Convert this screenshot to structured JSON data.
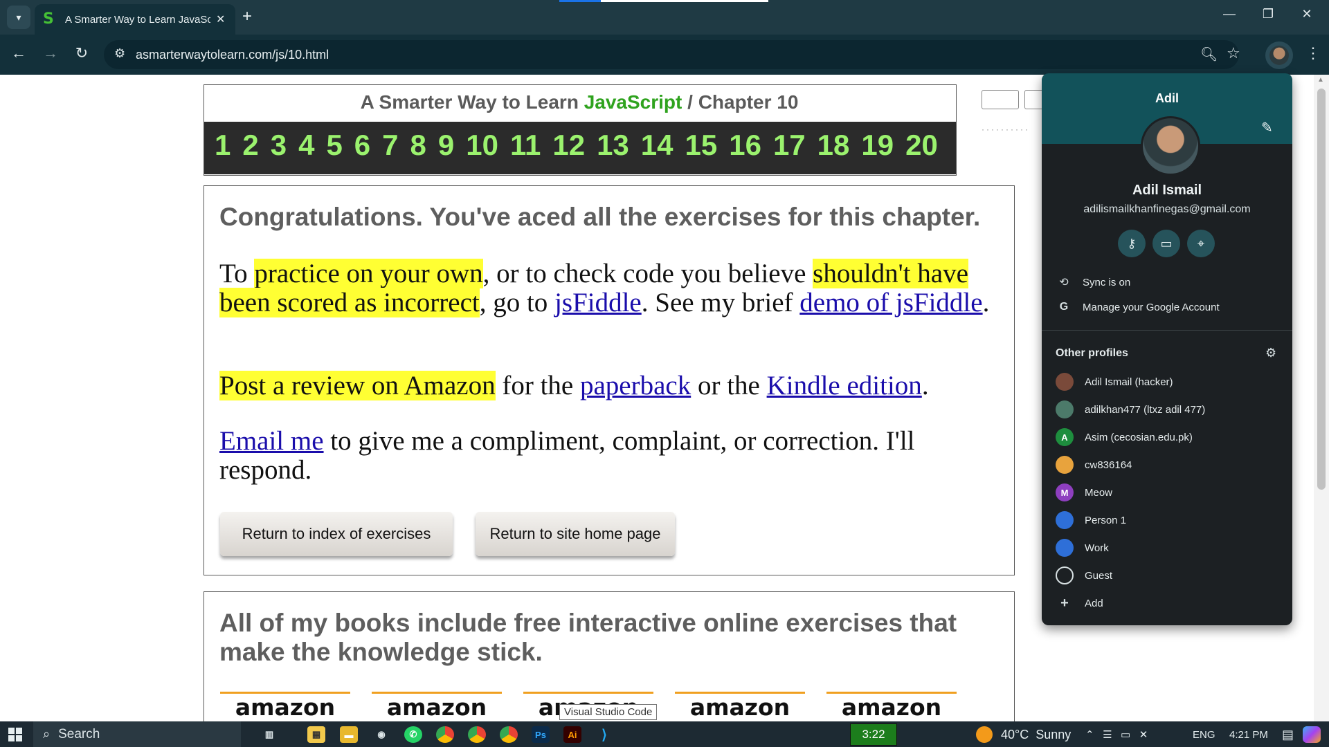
{
  "browser": {
    "tab_title": "A Smarter Way to Learn JavaScr",
    "tab_favicon": "S",
    "url": "asmarterwaytolearn.com/js/10.html",
    "icons": {
      "back": "arrow-left-icon",
      "forward": "arrow-right-icon",
      "reload": "reload-icon",
      "site_info": "tune-icon",
      "zoom": "zoom-icon",
      "bookmark": "star-icon",
      "menu": "kebab-icon"
    }
  },
  "page": {
    "header": {
      "prefix": "A Smarter Way to Learn ",
      "js": "JavaScript",
      "sep": " / ",
      "chapter": "Chapter 10"
    },
    "chapters": [
      "1",
      "2",
      "3",
      "4",
      "5",
      "6",
      "7",
      "8",
      "9",
      "10",
      "11",
      "12",
      "13",
      "14",
      "15",
      "16",
      "17",
      "18",
      "19",
      "20"
    ],
    "congrats": "Congratulations. You've aced all the exercises for this chapter.",
    "p1": {
      "t1": "To ",
      "hl1": "practice on your own",
      "t2": ", or to check code you believe ",
      "hl2": "shouldn't have been scored as incorrect",
      "t3": ", go to ",
      "link1": "jsFiddle",
      "t4": ". See my brief ",
      "link2": "demo of jsFiddle",
      "t5": "."
    },
    "p2": {
      "hl": "Post a review on Amazon",
      "t1": " for the ",
      "link1": "paperback",
      "t2": " or the ",
      "link2": "Kindle edition",
      "t3": "."
    },
    "p3": {
      "link": "Email me",
      "t1": " to give me a compliment, complaint, or correction. I'll respond."
    },
    "buttons": {
      "index": "Return to index of exercises",
      "home": "Return to site home page"
    },
    "books_text": "All of my books include free interactive online exercises that make the knowledge stick.",
    "amazon_label": "amazon",
    "tooltip": "Visual Studio Code"
  },
  "profile_panel": {
    "top_name": "Adil",
    "full_name": "Adil Ismail",
    "email": "adilismailkhanfinegas@gmail.com",
    "sync": "Sync is on",
    "manage": "Manage your Google Account",
    "other_profiles_title": "Other profiles",
    "profiles": [
      {
        "name": "Adil Ismail (hacker)",
        "avatar": "",
        "color": "#7a4a3a"
      },
      {
        "name": "adilkhan477 (ltxz adil 477)",
        "avatar": "",
        "color": "#4c7a6a"
      },
      {
        "name": "Asim (cecosian.edu.pk)",
        "avatar": "A",
        "color": "#1e8e3e"
      },
      {
        "name": "cw836164",
        "avatar": "",
        "color": "#e8a33d"
      },
      {
        "name": "Meow",
        "avatar": "M",
        "color": "#8e3fbf"
      },
      {
        "name": "Person 1",
        "avatar": "",
        "color": "#2e6fd8"
      },
      {
        "name": "Work",
        "avatar": "",
        "color": "#2e6fd8"
      }
    ],
    "guest": "Guest",
    "add": "Add"
  },
  "taskbar": {
    "search": "Search",
    "green_time": "3:22",
    "weather": "40°C  Sunny",
    "lang": "ENG",
    "clock": "4:21 PM"
  }
}
